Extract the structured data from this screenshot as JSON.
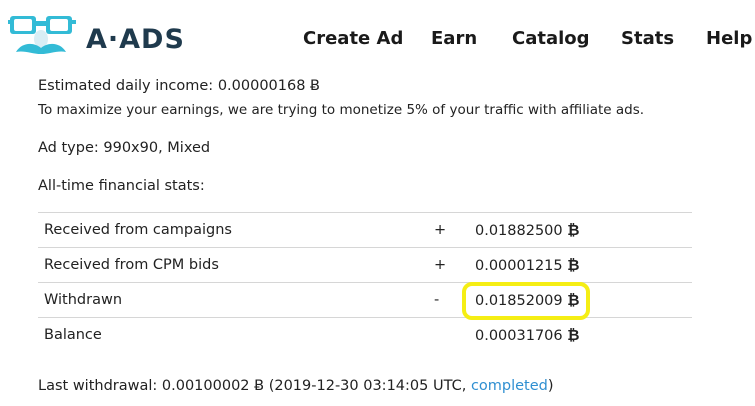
{
  "brand": {
    "name": "A·ADS",
    "accent": "#33bbd6"
  },
  "nav": [
    {
      "label": "Create Ad"
    },
    {
      "label": "Earn"
    },
    {
      "label": "Catalog"
    },
    {
      "label": "Stats"
    },
    {
      "label": "Help"
    }
  ],
  "income": {
    "label": "Estimated daily income:",
    "value": "0.00000168 Ƀ"
  },
  "note": "To maximize your earnings, we are trying to monetize 5% of your traffic with affiliate ads.",
  "ad_type": "Ad type: 990x90, Mixed",
  "financial_title": "All-time financial stats:",
  "currency_symbol": "₿",
  "stats": [
    {
      "label": "Received from campaigns",
      "sign": "+",
      "amount": "0.01882500"
    },
    {
      "label": "Received from CPM bids",
      "sign": "+",
      "amount": "0.00001215"
    },
    {
      "label": "Withdrawn",
      "sign": "-",
      "amount": "0.01852009"
    },
    {
      "label": "Balance",
      "sign": "",
      "amount": "0.00031706"
    }
  ],
  "last_withdrawal": {
    "prefix": "Last withdrawal: 0.00100002 Ƀ (2019-12-30 03:14:05 UTC, ",
    "status_link": "completed",
    "suffix": ")"
  },
  "highlight_color": "#f5ee14"
}
